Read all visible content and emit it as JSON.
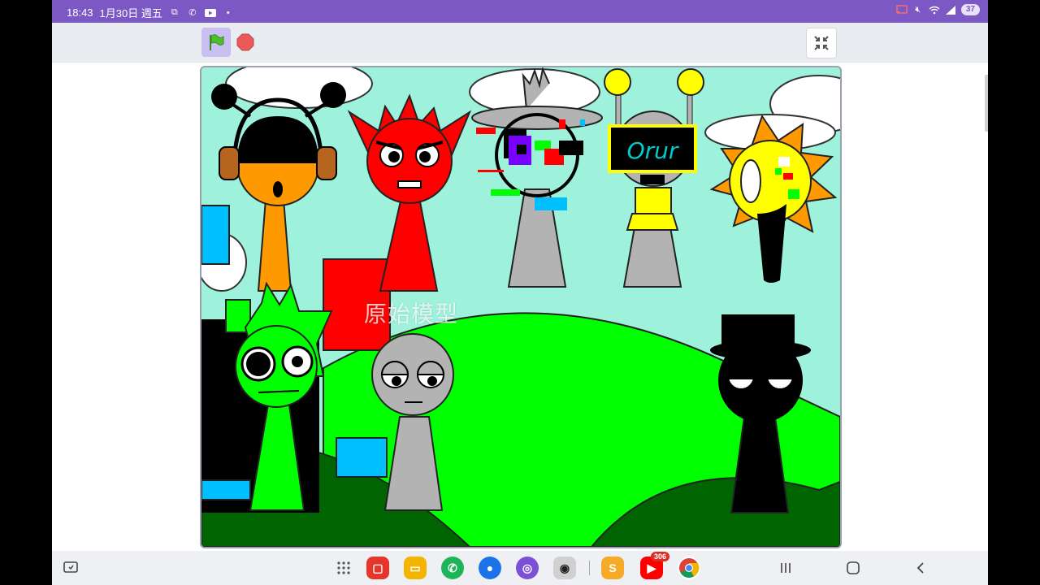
{
  "status_bar": {
    "time": "18:43",
    "date": "1月30日 週五",
    "battery": "37",
    "left_icons": [
      "screen-record-icon",
      "wifi-calling-icon",
      "youtube-icon",
      "dot-icon"
    ],
    "right_icons": [
      "cast-icon",
      "mute-icon",
      "wifi-icon",
      "signal-icon"
    ]
  },
  "toolbar": {
    "green_flag_icon": "green-flag-icon",
    "stop_icon": "stop-sign-icon",
    "fullscreen_icon": "exit-fullscreen-icon"
  },
  "stage": {
    "watermark": "原始模型",
    "sprite_text": "Orur",
    "colors": {
      "sky": "#9ef2dc",
      "grass_light": "#00ff00",
      "grass_dark": "#006400",
      "red": "#ff0000",
      "orange": "#ff9900",
      "yellow": "#ffff00",
      "gray": "#b3b3b3",
      "black": "#000000"
    }
  },
  "nav_bar": {
    "apps": [
      {
        "name": "app-drawer-icon"
      },
      {
        "name": "memo-app-icon",
        "color": "#e8352c"
      },
      {
        "name": "files-app-icon",
        "color": "#f4b400"
      },
      {
        "name": "phone-app-icon",
        "color": "#1fb35a"
      },
      {
        "name": "messages-app-icon",
        "color": "#1a73e8"
      },
      {
        "name": "browser-app-icon",
        "color": "#7b4fd6"
      },
      {
        "name": "camera-app-icon",
        "color": "#d0d0d0"
      },
      {
        "name": "scratch-app-icon",
        "color": "#f7a928"
      },
      {
        "name": "youtube-app-icon",
        "color": "#ff0000",
        "badge": "306"
      },
      {
        "name": "chrome-app-icon",
        "color": "#ffffff"
      }
    ],
    "system_buttons": [
      "recents-button",
      "home-button",
      "back-button"
    ]
  }
}
